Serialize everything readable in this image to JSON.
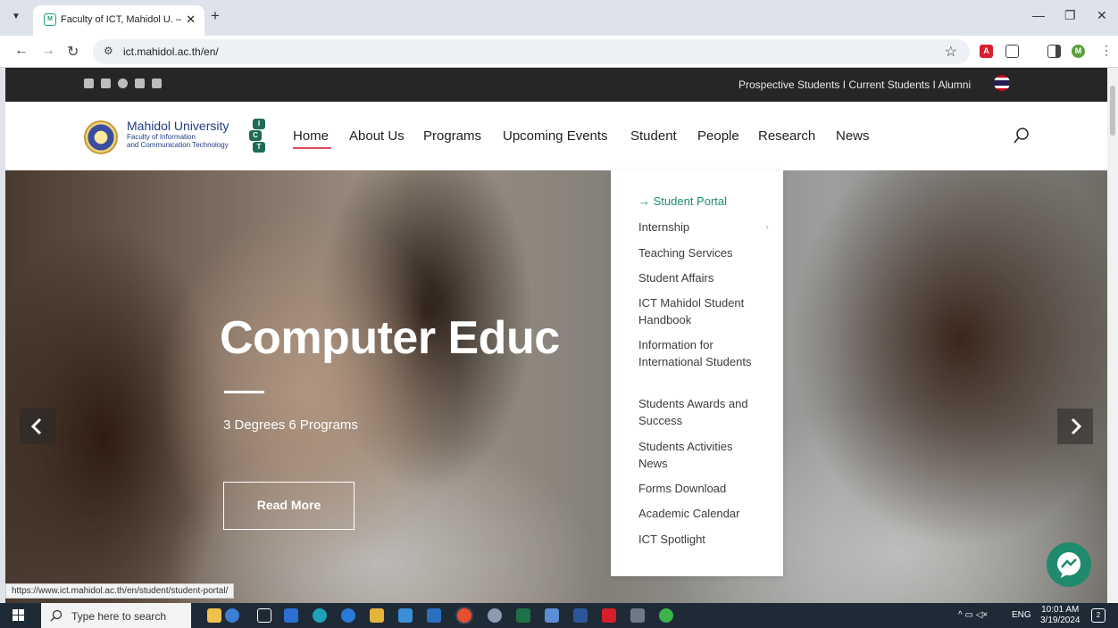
{
  "browser": {
    "tab_title": "Faculty of ICT, Mahidol U. – ONE",
    "url": "ict.mahidol.ac.th/en/",
    "status_url": "https://www.ict.mahidol.ac.th/en/student/student-portal/"
  },
  "topbar": {
    "links": "Prospective Students I Current Students I Alumni"
  },
  "logo": {
    "name": "Mahidol University",
    "sub1": "Faculty of Information",
    "sub2": "and Communication Technology"
  },
  "nav": {
    "items": [
      "Home",
      "About Us",
      "Programs",
      "Upcoming Events",
      "Student",
      "People",
      "Research",
      "News"
    ],
    "active": "Home"
  },
  "hero": {
    "title": "Computer Educ",
    "subtitle": "3 Degrees 6 Programs",
    "button": "Read More"
  },
  "dropdown": {
    "items": [
      {
        "label": "→ Student Portal",
        "active": true
      },
      {
        "label": "Internship",
        "has_submenu": true
      },
      {
        "label": "Teaching Services"
      },
      {
        "label": "Student Affairs"
      },
      {
        "label": "ICT Mahidol Student Handbook"
      },
      {
        "label": "Information for International Students"
      },
      {
        "label": "Students Awards and Success"
      },
      {
        "label": "Students Activities News"
      },
      {
        "label": "Forms Download"
      },
      {
        "label": "Academic Calendar"
      },
      {
        "label": "ICT Spotlight"
      }
    ],
    "chevron": "›"
  },
  "taskbar": {
    "search_placeholder": "Type here to search",
    "lang": "ENG",
    "time": "10:01 AM",
    "date": "3/19/2024",
    "notification_count": "2"
  },
  "colors": {
    "accent_green": "#1e8a72",
    "active_underline": "#d94b5c",
    "topbar_bg": "#262626"
  }
}
